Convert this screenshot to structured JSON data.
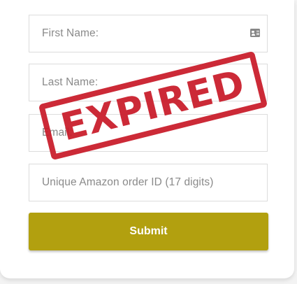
{
  "form": {
    "first_name_placeholder": "First Name:",
    "last_name_placeholder": "Last Name:",
    "email_placeholder": "Email:",
    "order_id_placeholder": "Unique Amazon order ID (17 digits)",
    "submit_label": "Submit"
  },
  "stamp": {
    "text": "EXPIRED",
    "color": "#c81826"
  },
  "colors": {
    "submit_background": "#b2a00f",
    "field_border": "#dcdcdc",
    "placeholder_text": "#8a8a8a"
  },
  "icons": {
    "first_name_field": "contact-card-icon"
  }
}
